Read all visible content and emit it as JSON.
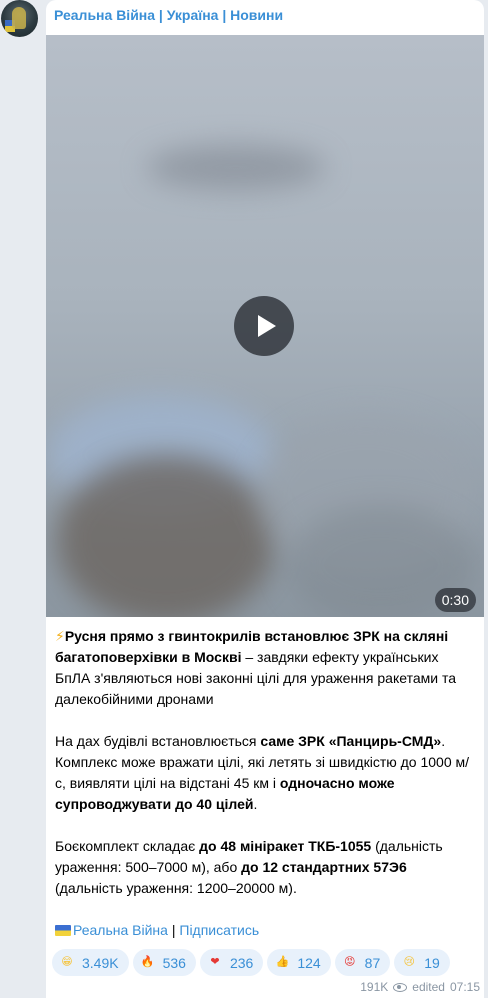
{
  "channel": {
    "name": "Реальна Війна | Україна | Новини"
  },
  "video": {
    "duration": "0:30"
  },
  "post": {
    "p1": {
      "bolt": "⚡",
      "bold": "Русня прямо з гвинтокрилів встановлює ЗРК на скляні багатоповерхівки в Москві",
      "rest": " – завдяки ефекту українських БпЛА з'являються нові законні цілі для ураження ракетами та далекобійними дронами"
    },
    "p2": {
      "a": "На дах будівлі встановлюється ",
      "b": "саме ЗРК «Панцирь-СМД»",
      "c": ". Комплекс може вражати цілі, які летять зі швидкістю до 1000 м/с, виявляти цілі на відстані 45 км і ",
      "d": "одночасно може супроводжувати до 40 цілей",
      "e": "."
    },
    "p3": {
      "a": "Боєкомплект складає ",
      "b": "до 48 мініракет ТКБ-1055",
      "c": " (дальність ураження: 500–7000 м), або ",
      "d": "до 12 стандартних 57Э6",
      "e": " (дальність ураження: 1200–20000 м)."
    },
    "footer": {
      "channel_link": "Реальна Війна",
      "separator": " | ",
      "subscribe_link": "Підписатись"
    }
  },
  "reactions": [
    {
      "emoji": "grinning-face",
      "count": "3.49K",
      "color": "#f5c33b"
    },
    {
      "emoji": "fire",
      "count": "536",
      "color": "#ff7a1a"
    },
    {
      "emoji": "red-heart",
      "count": "236",
      "color": "#e53935"
    },
    {
      "emoji": "thumbs-up",
      "count": "124",
      "color": "#f5c33b"
    },
    {
      "emoji": "angry-face",
      "count": "87",
      "color": "#e53935"
    },
    {
      "emoji": "crying-face",
      "count": "19",
      "color": "#f5c33b"
    }
  ],
  "meta": {
    "views": "191K",
    "status": "edited",
    "time": "07:15"
  },
  "colors": {
    "accent": "#3a8fd6",
    "background": "#e7ebf0",
    "bubble": "#ffffff"
  }
}
